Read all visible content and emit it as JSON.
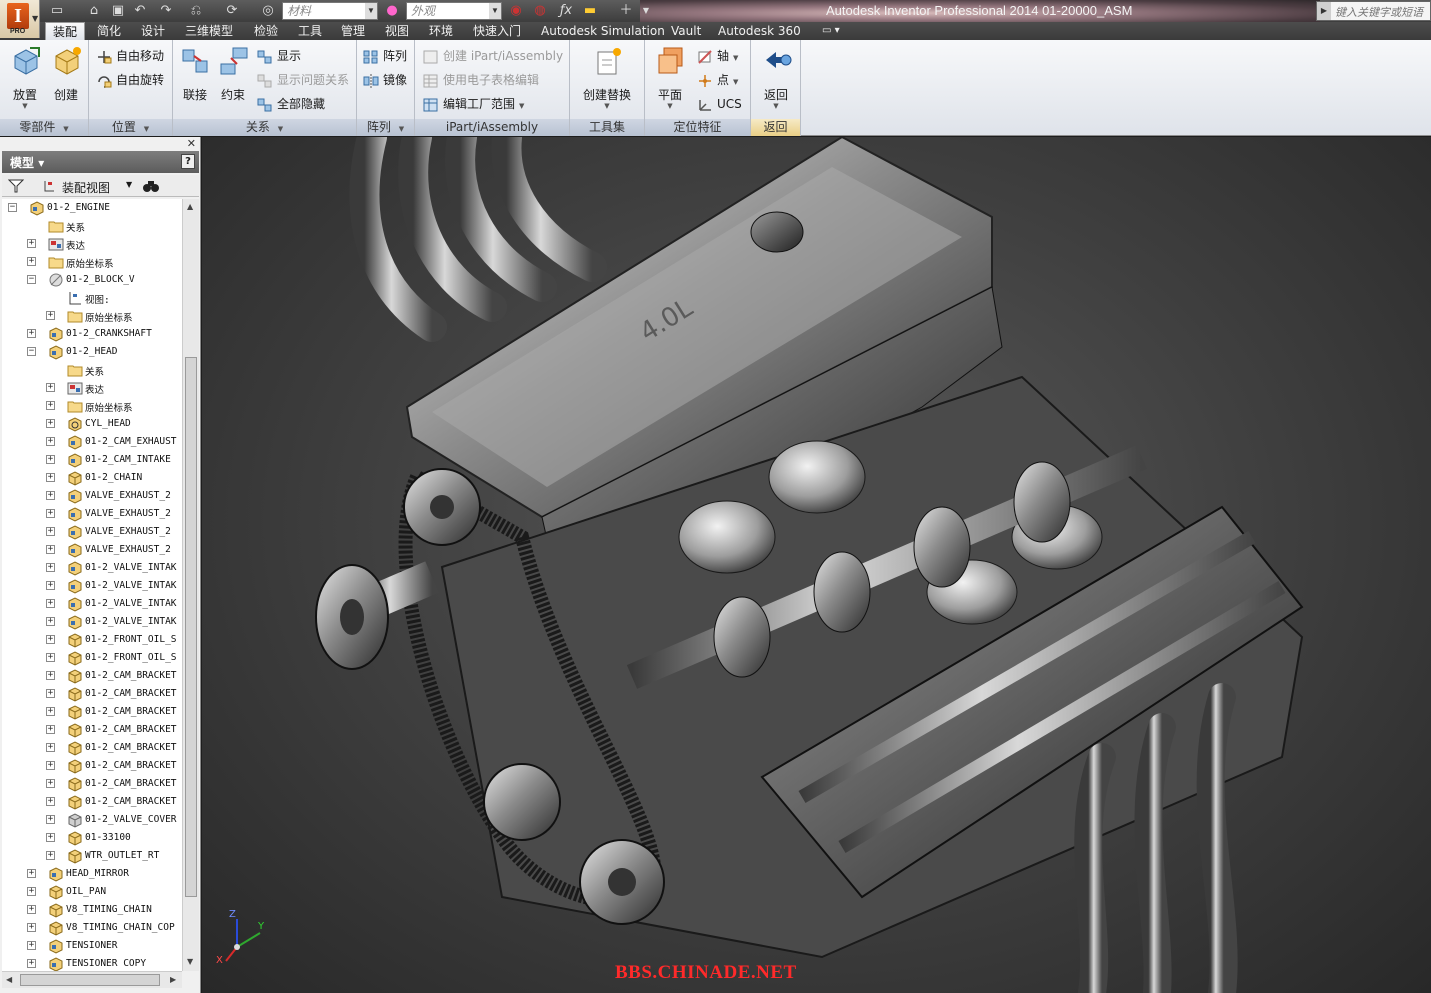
{
  "window": {
    "title": "Autodesk Inventor Professional 2014    01-20000_ASM",
    "app_badge": "PRO",
    "help_search_placeholder": "键入关键字或短语"
  },
  "quick_access": {
    "material_placeholder": "材料",
    "appearance_placeholder": "外观"
  },
  "tabs": [
    {
      "label": "装配",
      "active": true
    },
    {
      "label": "简化"
    },
    {
      "label": "设计"
    },
    {
      "label": "三维模型"
    },
    {
      "label": "检验"
    },
    {
      "label": "工具"
    },
    {
      "label": "管理"
    },
    {
      "label": "视图"
    },
    {
      "label": "环境"
    },
    {
      "label": "快速入门"
    },
    {
      "label": "Autodesk Simulation"
    },
    {
      "label": "Vault"
    },
    {
      "label": "Autodesk 360"
    }
  ],
  "ribbon": {
    "component": {
      "title": "零部件",
      "place": "放置",
      "create": "创建"
    },
    "position": {
      "title": "位置",
      "free_move": "自由移动",
      "free_rotate": "自由旋转"
    },
    "relationships": {
      "title": "关系",
      "joint": "联接",
      "constrain": "约束",
      "show": "显示",
      "show_sick": "显示问题关系",
      "hide_all": "全部隐藏"
    },
    "pattern": {
      "title": "阵列",
      "pattern": "阵列",
      "mirror": "镜像"
    },
    "ipart": {
      "title": "iPart/iAssembly",
      "create": "创建 iPart/iAssembly",
      "spreadsheet": "使用电子表格编辑",
      "factory_scope": "编辑工厂范围"
    },
    "productivity": {
      "title": "工具集",
      "create_sub": "创建替换"
    },
    "work_features": {
      "title": "定位特征",
      "plane": "平面",
      "axis": "轴",
      "point": "点",
      "ucs": "UCS"
    },
    "return": {
      "title": "返回",
      "return": "返回"
    }
  },
  "browser": {
    "title": "模型",
    "view_mode": "装配视图",
    "items": [
      {
        "label": "01-2_ENGINE",
        "icon": "assembly",
        "exp": "-"
      },
      {
        "label": "关系",
        "icon": "folder"
      },
      {
        "label": "表达",
        "icon": "views",
        "exp": "+"
      },
      {
        "label": "原始坐标系",
        "icon": "folder",
        "exp": "+"
      },
      {
        "label": "01-2_BLOCK_V",
        "icon": "suppressed",
        "exp": "-"
      },
      {
        "label": "视图:",
        "icon": "views-small"
      },
      {
        "label": "原始坐标系",
        "icon": "folder",
        "exp": "+"
      },
      {
        "label": "01-2_CRANKSHAFT",
        "icon": "assembly",
        "exp": "+"
      },
      {
        "label": "01-2_HEAD",
        "icon": "assembly",
        "exp": "-"
      },
      {
        "label": "关系",
        "icon": "folder"
      },
      {
        "label": "表达",
        "icon": "views",
        "exp": "+"
      },
      {
        "label": "原始坐标系",
        "icon": "folder",
        "exp": "+"
      },
      {
        "label": "CYL_HEAD",
        "icon": "part-adaptive",
        "exp": "+"
      },
      {
        "label": "01-2_CAM_EXHAUST",
        "icon": "assembly",
        "exp": "+"
      },
      {
        "label": "01-2_CAM_INTAKE",
        "icon": "assembly",
        "exp": "+"
      },
      {
        "label": "01-2_CHAIN",
        "icon": "part",
        "exp": "+"
      },
      {
        "label": "VALVE_EXHAUST_2",
        "icon": "assembly",
        "exp": "+"
      },
      {
        "label": "VALVE_EXHAUST_2",
        "icon": "assembly",
        "exp": "+"
      },
      {
        "label": "VALVE_EXHAUST_2",
        "icon": "assembly",
        "exp": "+"
      },
      {
        "label": "VALVE_EXHAUST_2",
        "icon": "assembly",
        "exp": "+"
      },
      {
        "label": "01-2_VALVE_INTAK",
        "icon": "assembly",
        "exp": "+"
      },
      {
        "label": "01-2_VALVE_INTAK",
        "icon": "assembly",
        "exp": "+"
      },
      {
        "label": "01-2_VALVE_INTAK",
        "icon": "assembly",
        "exp": "+"
      },
      {
        "label": "01-2_VALVE_INTAK",
        "icon": "assembly",
        "exp": "+"
      },
      {
        "label": "01-2_FRONT_OIL_S",
        "icon": "part",
        "exp": "+"
      },
      {
        "label": "01-2_FRONT_OIL_S",
        "icon": "part",
        "exp": "+"
      },
      {
        "label": "01-2_CAM_BRACKET",
        "icon": "part",
        "exp": "+"
      },
      {
        "label": "01-2_CAM_BRACKET",
        "icon": "part",
        "exp": "+"
      },
      {
        "label": "01-2_CAM_BRACKET",
        "icon": "part",
        "exp": "+"
      },
      {
        "label": "01-2_CAM_BRACKET",
        "icon": "part",
        "exp": "+"
      },
      {
        "label": "01-2_CAM_BRACKET",
        "icon": "part",
        "exp": "+"
      },
      {
        "label": "01-2_CAM_BRACKET",
        "icon": "part",
        "exp": "+"
      },
      {
        "label": "01-2_CAM_BRACKET",
        "icon": "part",
        "exp": "+"
      },
      {
        "label": "01-2_CAM_BRACKET",
        "icon": "part",
        "exp": "+"
      },
      {
        "label": "01-2_VALVE_COVER",
        "icon": "part-grey",
        "exp": "+"
      },
      {
        "label": "01-33100",
        "icon": "part",
        "exp": "+"
      },
      {
        "label": "WTR_OUTLET_RT",
        "icon": "part",
        "exp": "+"
      },
      {
        "label": "HEAD_MIRROR",
        "icon": "assembly",
        "exp": "+"
      },
      {
        "label": "OIL_PAN",
        "icon": "part",
        "exp": "+"
      },
      {
        "label": "V8_TIMING_CHAIN",
        "icon": "part",
        "exp": "+"
      },
      {
        "label": "V8_TIMING_CHAIN_COP",
        "icon": "part",
        "exp": "+"
      },
      {
        "label": "TENSIONER",
        "icon": "assembly",
        "exp": "+"
      },
      {
        "label": "TENSIONER COPY",
        "icon": "assembly",
        "exp": "+"
      }
    ]
  },
  "viewport": {
    "engraving": "4.0L",
    "watermark": "BBS.CHINADE.NET",
    "triad": {
      "x": "X",
      "y": "Y",
      "z": "Z"
    }
  }
}
